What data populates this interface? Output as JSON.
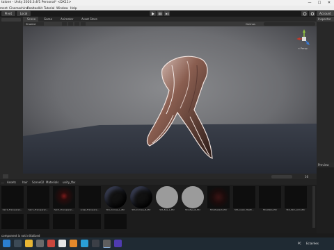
{
  "window": {
    "title": "talone - Unity 2020.3.4f1 Personal* <DX11>",
    "controls": [
      "—",
      "□",
      "✕"
    ]
  },
  "menu": [
    "ment",
    "Cinemachine",
    "Realtoolkit",
    "Tutorial",
    "Window",
    "Help"
  ],
  "toolbar": {
    "pivot_label": "Pivot",
    "local_label": "Local",
    "account_label": "Account"
  },
  "tabs": {
    "scene": "Scene",
    "game": "Game",
    "animator": "Animator",
    "asset_store": "Asset Store"
  },
  "scene_toolbar": {
    "shading_mode": "Shaded",
    "gizmos": "Gizmos",
    "search_placeholder": "All"
  },
  "gizmo": {
    "label": "< Persp"
  },
  "right_panel": {
    "inspector_tab": "Inspector",
    "preview_tab": "Preview"
  },
  "project": {
    "breadcrumb": [
      "...",
      "Assets",
      "hair",
      "Scene02",
      "Materials",
      "unity_fbx"
    ],
    "asset_count": "16",
    "assets_row1": [
      {
        "label": "hair1_Transparen...",
        "kind": "dark"
      },
      {
        "label": "hair1_Transparen...",
        "kind": "dark"
      },
      {
        "label": "hair1_Transparen...",
        "kind": "red"
      },
      {
        "label": "scalp_Transpare...",
        "kind": "dark"
      },
      {
        "label": "Std_Cornea_L_Pbr",
        "kind": "sphere-dark"
      },
      {
        "label": "Std_Cornea_R_Pbr",
        "kind": "sphere-dark"
      },
      {
        "label": "Std_Eye_L_Pbr",
        "kind": "sphere-grey"
      },
      {
        "label": "Std_Eye_R_Pbr",
        "kind": "sphere-grey"
      },
      {
        "label": "Std_Eyelash_Pbr",
        "kind": "dark-red"
      },
      {
        "label": "Std_Lower_Teeth...",
        "kind": "dark"
      },
      {
        "label": "Std_Nails_Pbr",
        "kind": "dark"
      },
      {
        "label": "Std_Skin_Arm_Pbr",
        "kind": "dark"
      }
    ],
    "assets_row2_count": 5
  },
  "status": {
    "message": "component is not initialized"
  },
  "taskbar": {
    "tray_lang": "PC",
    "tray_locale": "Eclairées"
  }
}
